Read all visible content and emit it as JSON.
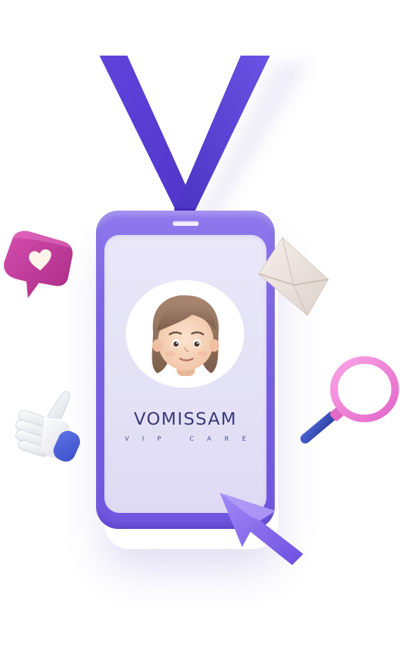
{
  "badge": {
    "brand_name": "VOMISSAM",
    "tagline": "VIP CARE"
  },
  "icons": {
    "lanyard": "lanyard-icon",
    "avatar": "avatar-girl-icon",
    "like_bubble": "heart-speech-bubble-icon",
    "mail": "envelope-icon",
    "thumbs_up": "thumbs-up-icon",
    "search": "magnifying-glass-icon",
    "cursor": "arrow-cursor-icon"
  },
  "colors": {
    "lanyard": "#5a3fd6",
    "card": "#7a62e6",
    "card_inner": "#e6e3f7",
    "brand_text": "#3a3a78",
    "heart_bubble": "#c23a9a",
    "magnifier_ring": "#f07fd6",
    "magnifier_handle": "#3a4fb8",
    "cursor": "#8a6cf0"
  }
}
